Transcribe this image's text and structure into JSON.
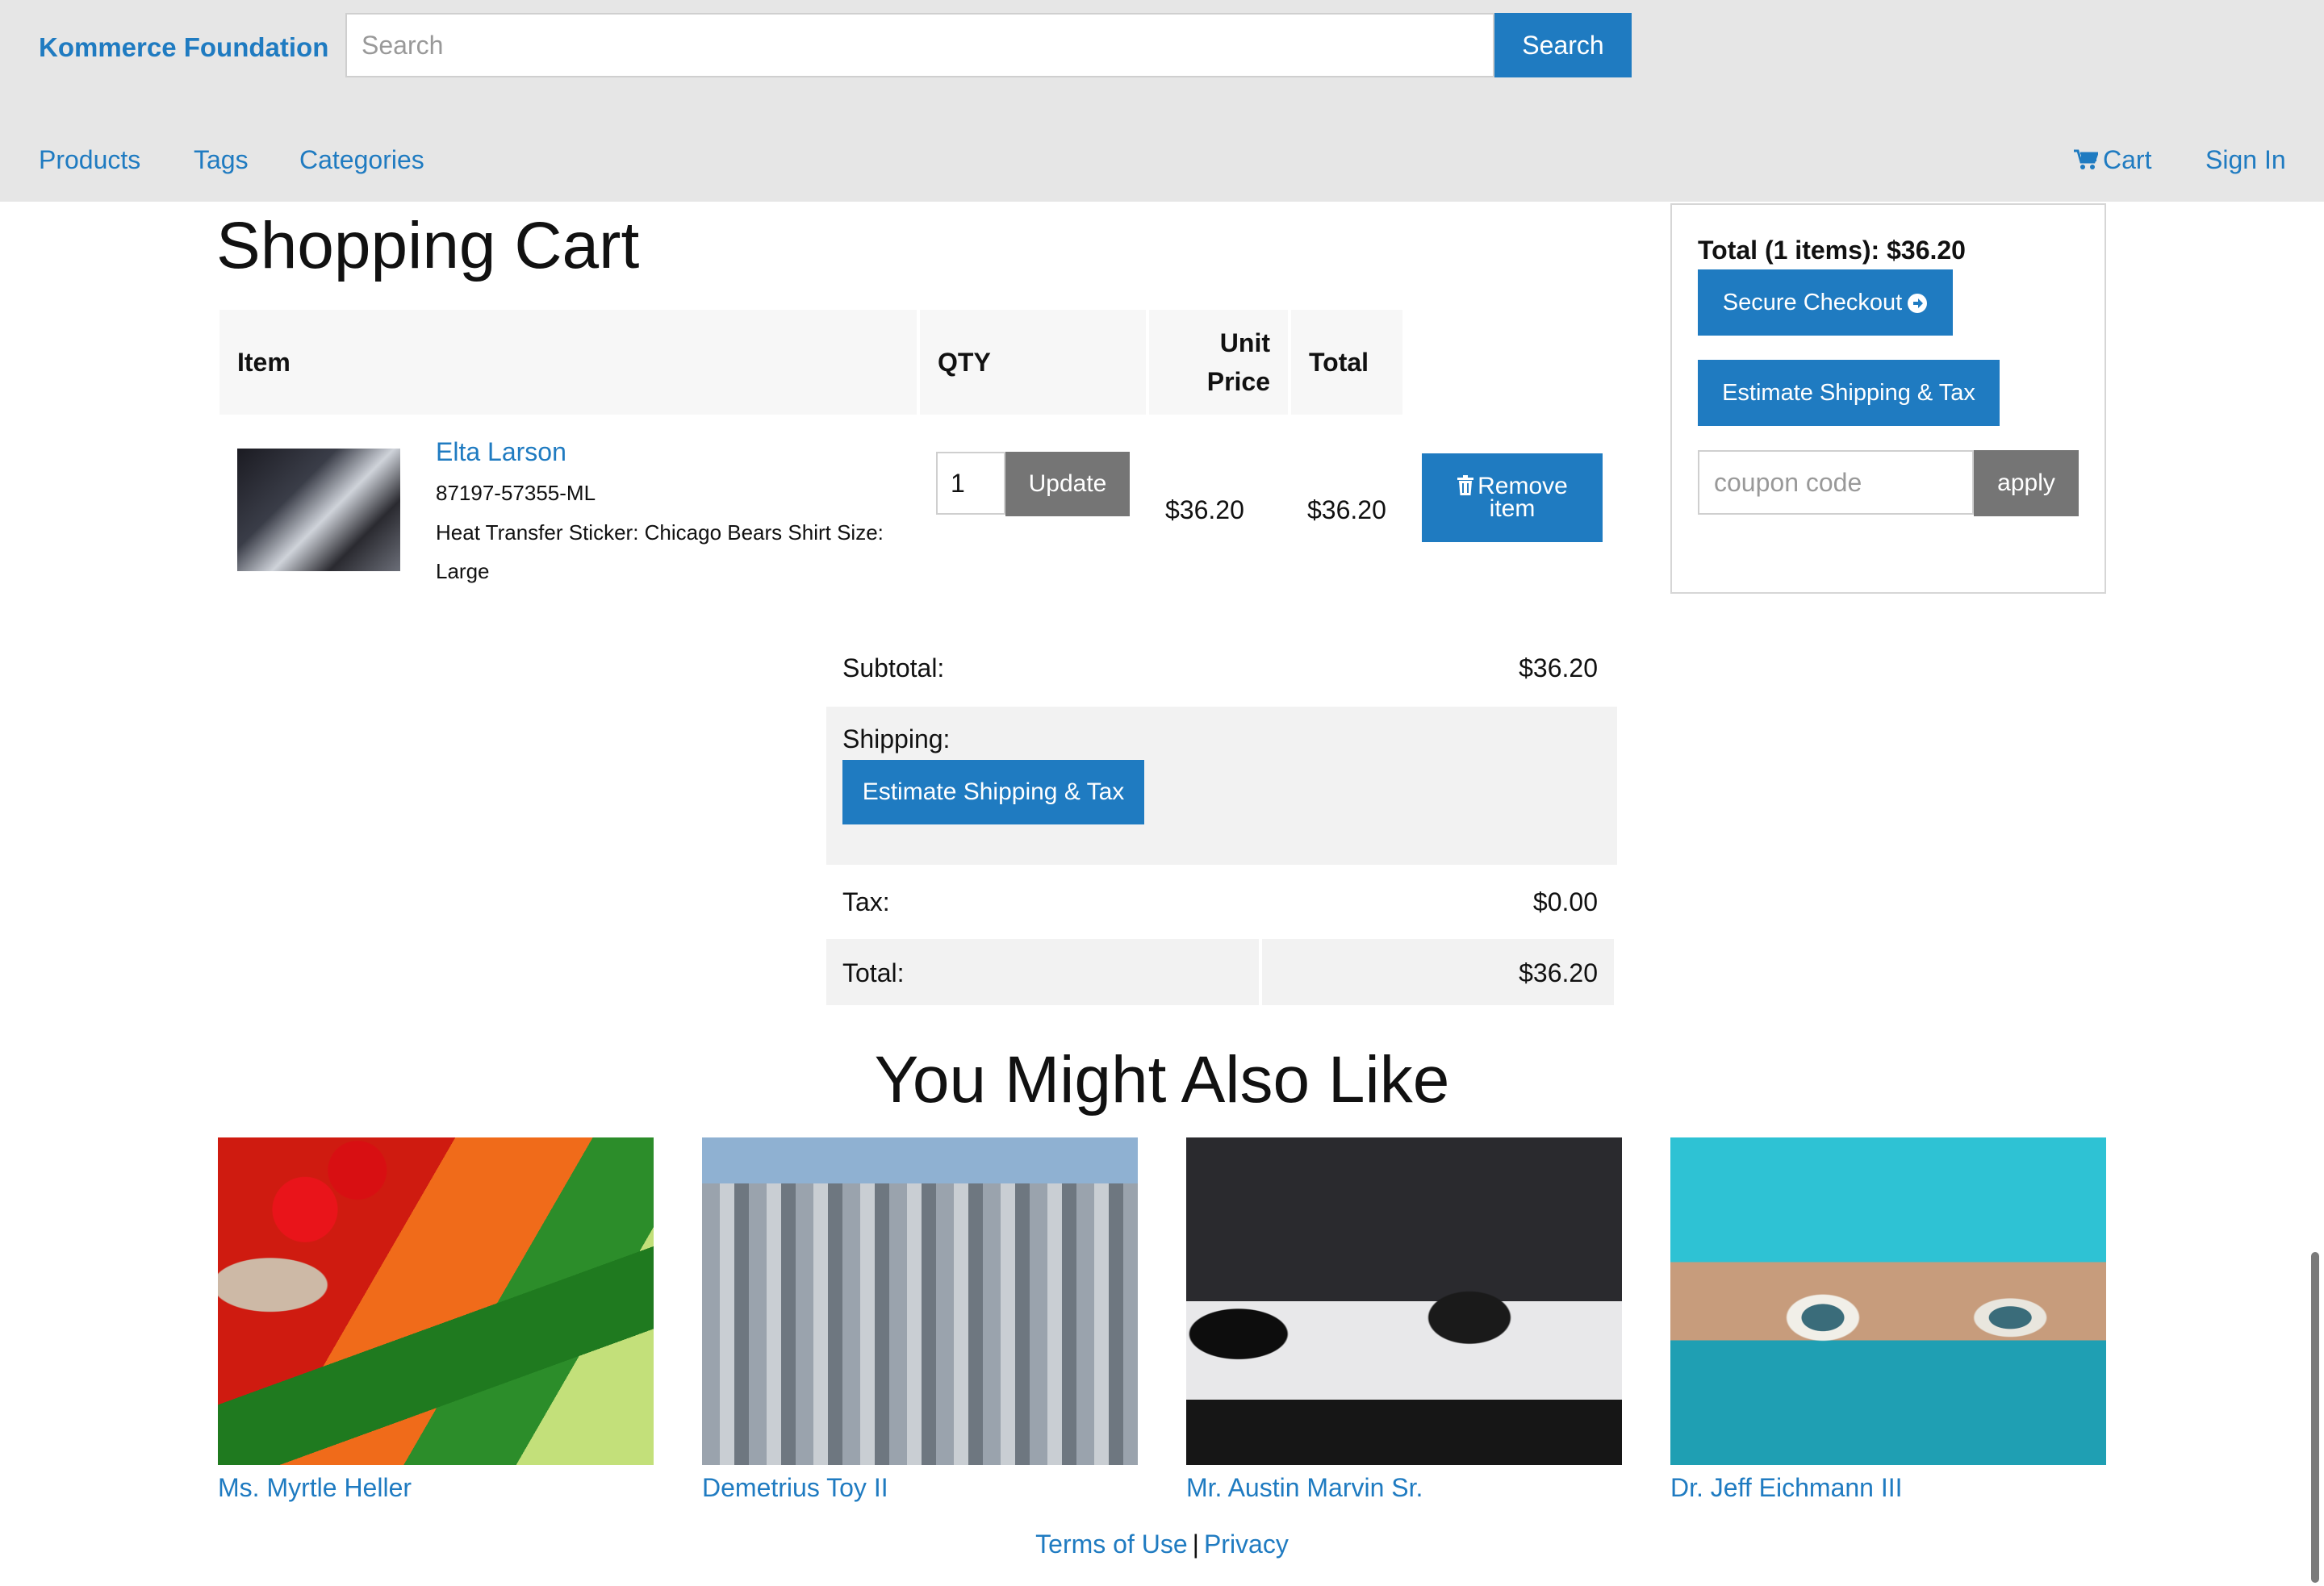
{
  "colors": {
    "accent": "#1f7bc1",
    "navbar_bg": "#e6e6e6",
    "secondary_btn": "#757575"
  },
  "navbar": {
    "brand": "Kommerce Foundation",
    "search_placeholder": "Search",
    "search_button": "Search",
    "links": {
      "products": "Products",
      "tags": "Tags",
      "categories": "Categories"
    },
    "cart": "Cart",
    "sign_in": "Sign In"
  },
  "cart": {
    "title": "Shopping Cart",
    "headers": {
      "item": "Item",
      "qty": "QTY",
      "unit_price": "Unit Price",
      "total": "Total"
    },
    "line": {
      "name": "Elta Larson",
      "sku": "87197-57355-ML",
      "description": "Heat Transfer Sticker: Chicago Bears Shirt Size: Large",
      "qty": "1",
      "update_button": "Update",
      "unit_price": "$36.20",
      "total": "$36.20",
      "remove_button_line1": "Remove",
      "remove_button_line2": "item"
    },
    "totals": {
      "subtotal_label": "Subtotal:",
      "subtotal_value": "$36.20",
      "shipping_label": "Shipping:",
      "estimate_button": "Estimate Shipping & Tax",
      "tax_label": "Tax:",
      "tax_value": "$0.00",
      "total_label": "Total:",
      "total_value": "$36.20"
    }
  },
  "summary": {
    "total_text": "Total (1 items): $36.20",
    "checkout_button": "Secure Checkout",
    "estimate_button": "Estimate Shipping & Tax",
    "coupon_placeholder": "coupon code",
    "apply_button": "apply"
  },
  "recommendations": {
    "title": "You Might Also Like",
    "items": [
      {
        "name": "Ms. Myrtle Heller"
      },
      {
        "name": "Demetrius Toy II"
      },
      {
        "name": "Mr. Austin Marvin Sr."
      },
      {
        "name": "Dr. Jeff Eichmann III"
      }
    ]
  },
  "footer": {
    "terms": "Terms of Use",
    "separator": "|",
    "privacy": "Privacy"
  }
}
